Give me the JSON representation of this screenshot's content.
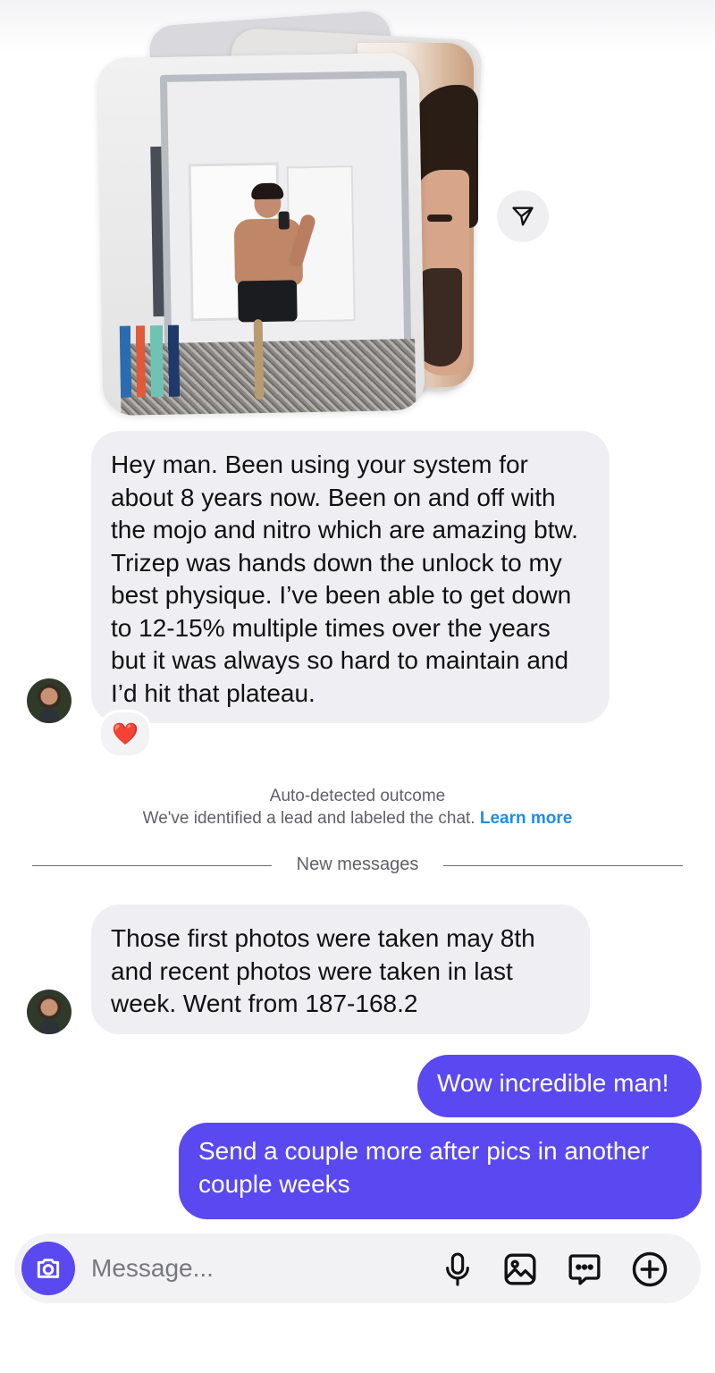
{
  "messages": {
    "incoming_1": "Hey man. Been using your system for about 8 years now. Been on and off with the mojo and nitro which are amazing btw. Trizep was hands down the unlock to my best physique. I’ve been able to get down to 12-15% multiple times over the years but it was always so hard to maintain and I’d hit that plateau.",
    "reaction": "❤️",
    "incoming_2": "Those first photos were taken may 8th and recent photos were taken in last week. Went from 187-168.2",
    "outgoing_1": "Wow incredible man!",
    "outgoing_2": "Send a couple more after pics in another couple weeks"
  },
  "system_notice": {
    "title": "Auto-detected outcome",
    "body": "We've identified a lead and labeled the chat.",
    "link": "Learn more"
  },
  "divider_label": "New messages",
  "composer": {
    "placeholder": "Message...",
    "icons": [
      "camera-icon",
      "microphone-icon",
      "image-icon",
      "message-options-icon",
      "plus-circle-icon"
    ]
  },
  "colors": {
    "accent": "#5a49f0",
    "incoming_bubble": "#efeff3",
    "link": "#1d8cf0"
  }
}
